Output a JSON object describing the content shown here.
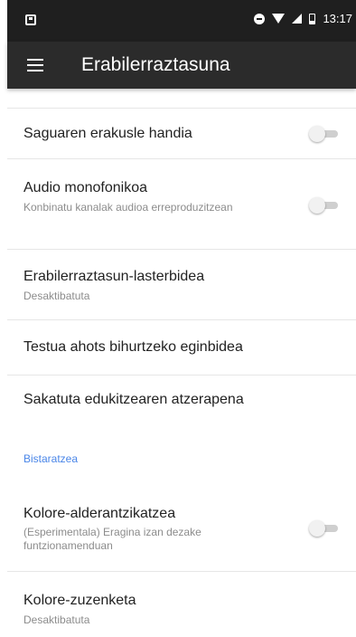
{
  "status_bar": {
    "time": "13:17"
  },
  "app_bar": {
    "title": "Erabilerraztasuna"
  },
  "list": {
    "items": [
      {
        "title": "Saguaren erakusle handia",
        "summary": "",
        "switch_on": false
      },
      {
        "title": "Audio monofonikoa",
        "summary": "Konbinatu kanalak audioa erreproduzitzean",
        "switch_on": false
      },
      {
        "title": "Erabilerraztasun-lasterbidea",
        "summary": "Desaktibatuta"
      },
      {
        "title": "Testua ahots bihurtzeko eginbidea",
        "summary": ""
      },
      {
        "title": "Sakatuta edukitzearen atzerapena",
        "summary": ""
      }
    ],
    "section_header": "Bistaratzea",
    "section_items": [
      {
        "title": "Kolore-alderantzikatzea",
        "summary": "(Esperimentala) Eragina izan dezake funtzionamenduan",
        "switch_on": false
      },
      {
        "title": "Kolore-zuzenketa",
        "summary": "Desaktibatuta"
      }
    ]
  },
  "colors": {
    "accent": "#4a86e8",
    "app_bar": "#2b2b2b",
    "status_bar": "#1f1f1f"
  },
  "icons": [
    "menu-icon",
    "dnd-icon",
    "wifi-icon",
    "signal-icon",
    "battery-icon"
  ]
}
